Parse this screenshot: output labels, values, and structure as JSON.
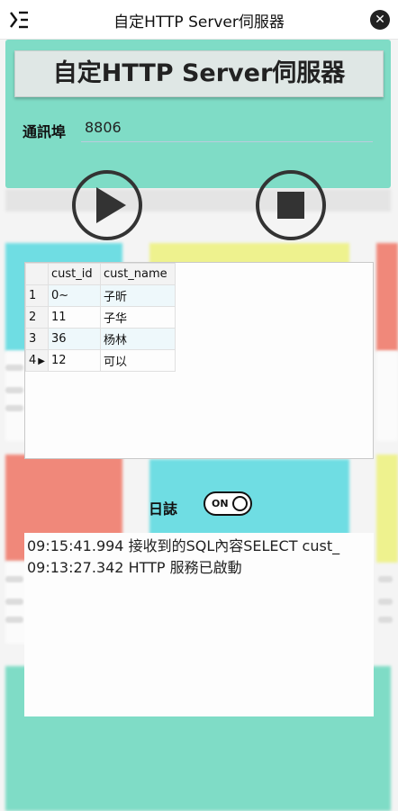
{
  "window": {
    "title": "自定HTTP Server伺服器"
  },
  "header": {
    "big_title": "自定HTTP Server伺服器"
  },
  "port": {
    "label": "通訊埠",
    "value": "8806"
  },
  "controls": {
    "play_icon": "play-icon",
    "stop_icon": "stop-icon"
  },
  "grid": {
    "columns": [
      "cust_id",
      "cust_name"
    ],
    "rows": [
      {
        "num": "1",
        "marker": "",
        "cust_id": "0~",
        "cust_name": "子昕"
      },
      {
        "num": "2",
        "marker": "",
        "cust_id": "11",
        "cust_name": "子华"
      },
      {
        "num": "3",
        "marker": "",
        "cust_id": "36",
        "cust_name": "杨林"
      },
      {
        "num": "4",
        "marker": "▶",
        "cust_id": "12",
        "cust_name": "可以"
      }
    ]
  },
  "log": {
    "label": "日誌",
    "toggle_label": "ON",
    "lines": [
      "09:15:41.994 接收到的SQL內容SELECT cust_",
      "09:13:27.342 HTTP 服務已啟動"
    ]
  },
  "colors": {
    "teal": "#7fdcc6",
    "cyan": "#6fdde3",
    "yellow": "#eef28e",
    "salmon": "#f0887a"
  }
}
